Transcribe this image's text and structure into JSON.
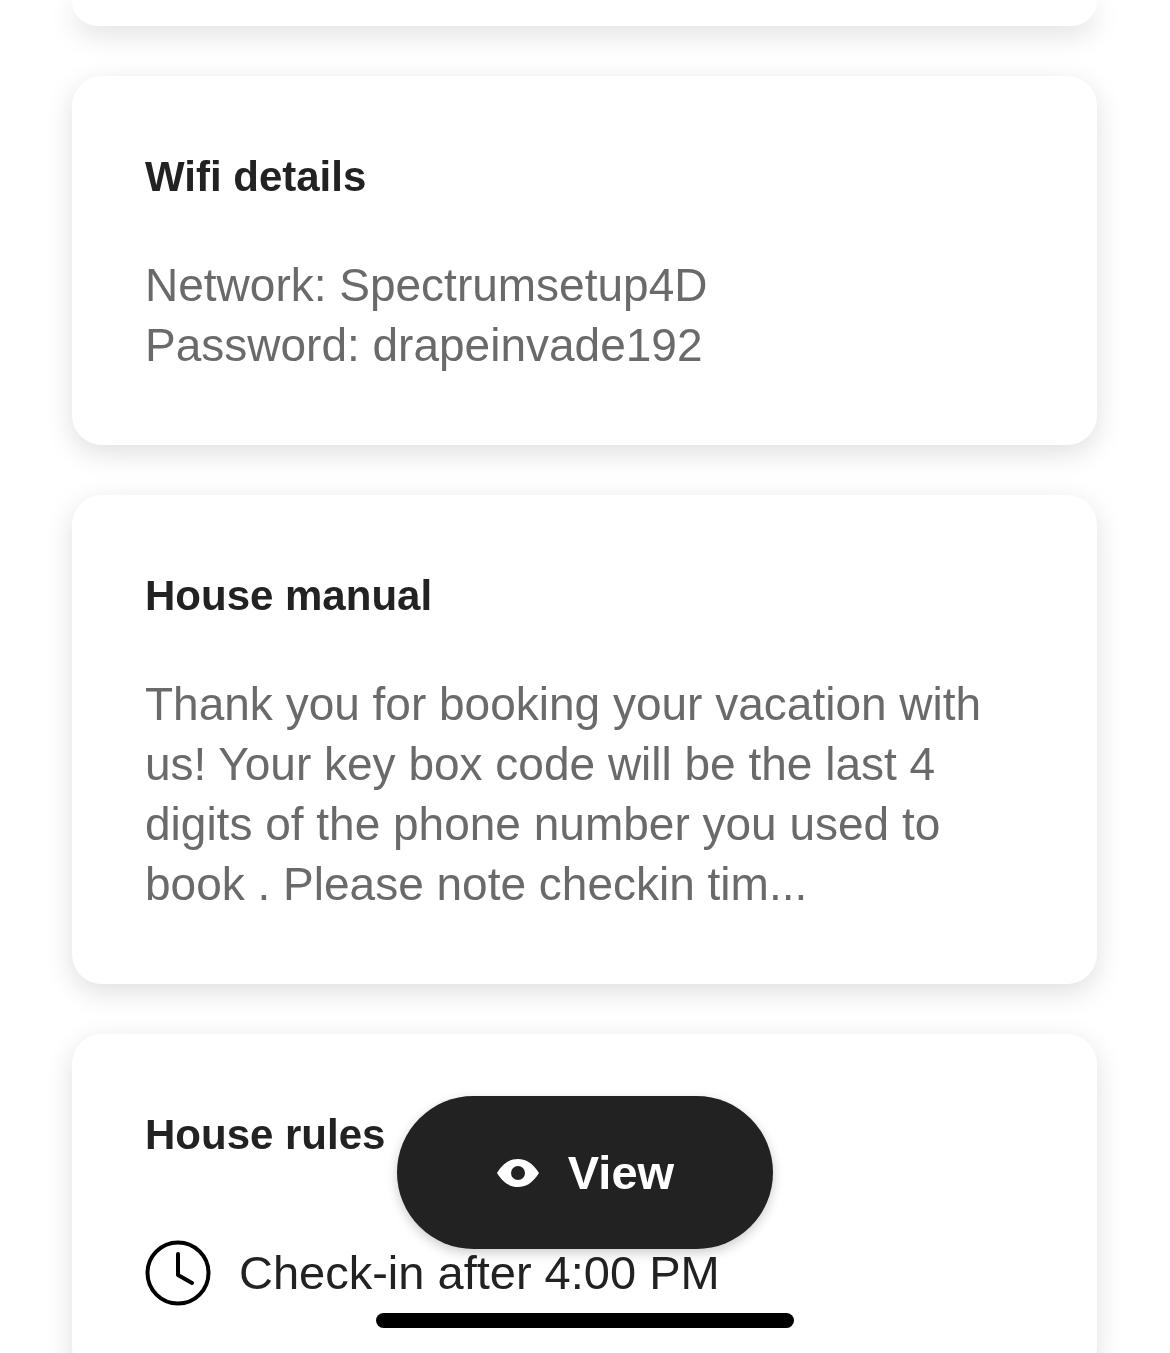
{
  "cards": [
    {
      "kind": "details",
      "title": "Wifi details",
      "lines": [
        "Network: Spectrumsetup4D",
        "Password: drapeinvade192"
      ]
    },
    {
      "kind": "paragraph",
      "title": "House manual",
      "text": "Thank you for booking your vacation with us! Your key box code will be the last 4 digits of the phone number you used to book . Please note checkin tim..."
    },
    {
      "kind": "rules",
      "title": "House rules",
      "rules": [
        {
          "text": "Check-in after 4:00 PM"
        }
      ]
    }
  ],
  "floating_button": {
    "label": "View"
  }
}
